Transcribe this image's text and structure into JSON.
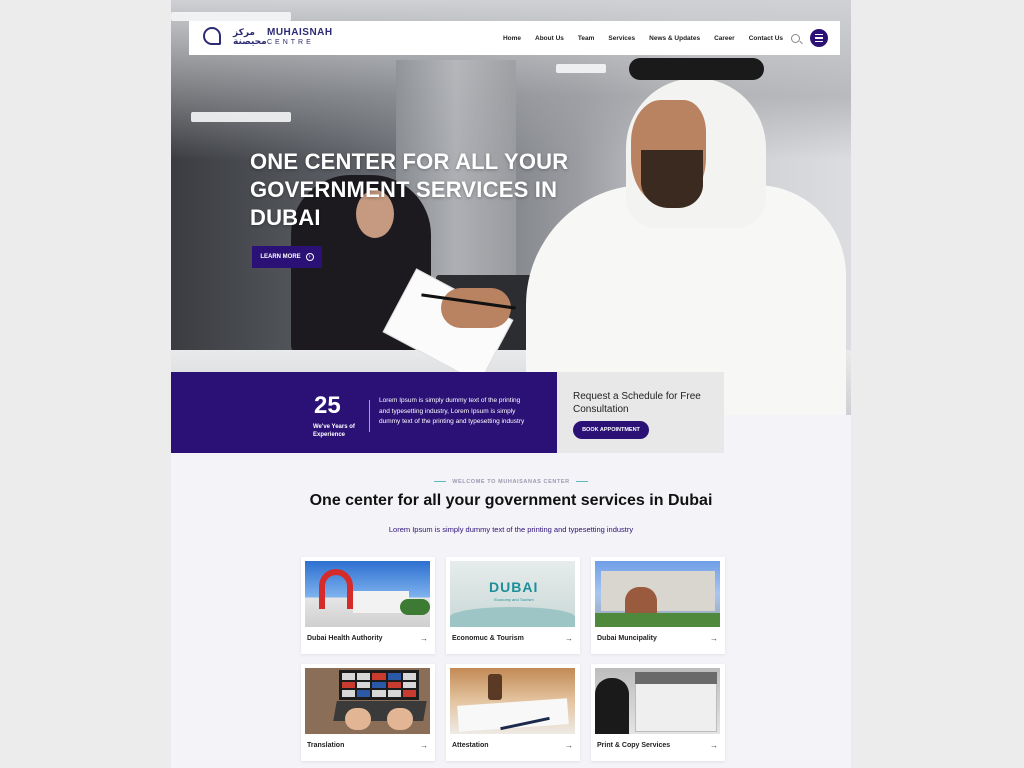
{
  "header": {
    "logo_text": "MUHAISNAH",
    "logo_subtext": "CENTRE",
    "logo_arabic": "مركز محيصنة",
    "nav": [
      "Home",
      "About Us",
      "Team",
      "Services",
      "News & Updates",
      "Career",
      "Contact Us"
    ]
  },
  "hero": {
    "title": "ONE CENTER FOR ALL YOUR GOVERNMENT SERVICES IN DUBAI",
    "cta_label": "LEARN MORE"
  },
  "stats": {
    "years": "25",
    "years_label": "We've Years of Experience",
    "text": "Lorem Ipsum is simply dummy text of the printing and typesetting industry, Lorem Ipsum is simply dummy text of the printing and typesetting industry"
  },
  "consult": {
    "title": "Request a Schedule for Free Consultation",
    "button": "BOOK APPOINTMENT"
  },
  "welcome": {
    "eyebrow": "WELCOME TO MUHAISANAS CENTER",
    "title": "One center for all your government services in Dubai",
    "subtitle": "Lorem Ipsum is simply dummy text of the printing and typesetting industry"
  },
  "services": [
    {
      "label": "Dubai Health Authority",
      "img": "dha"
    },
    {
      "label": "Economuc & Tourism",
      "img": "det"
    },
    {
      "label": "Dubai Muncipality",
      "img": "dm"
    },
    {
      "label": "Translation",
      "img": "tr"
    },
    {
      "label": "Attestation",
      "img": "at"
    },
    {
      "label": "Print & Copy Services",
      "img": "pc"
    }
  ],
  "colors": {
    "brand": "#2b1176",
    "accent": "#5db9b9"
  }
}
